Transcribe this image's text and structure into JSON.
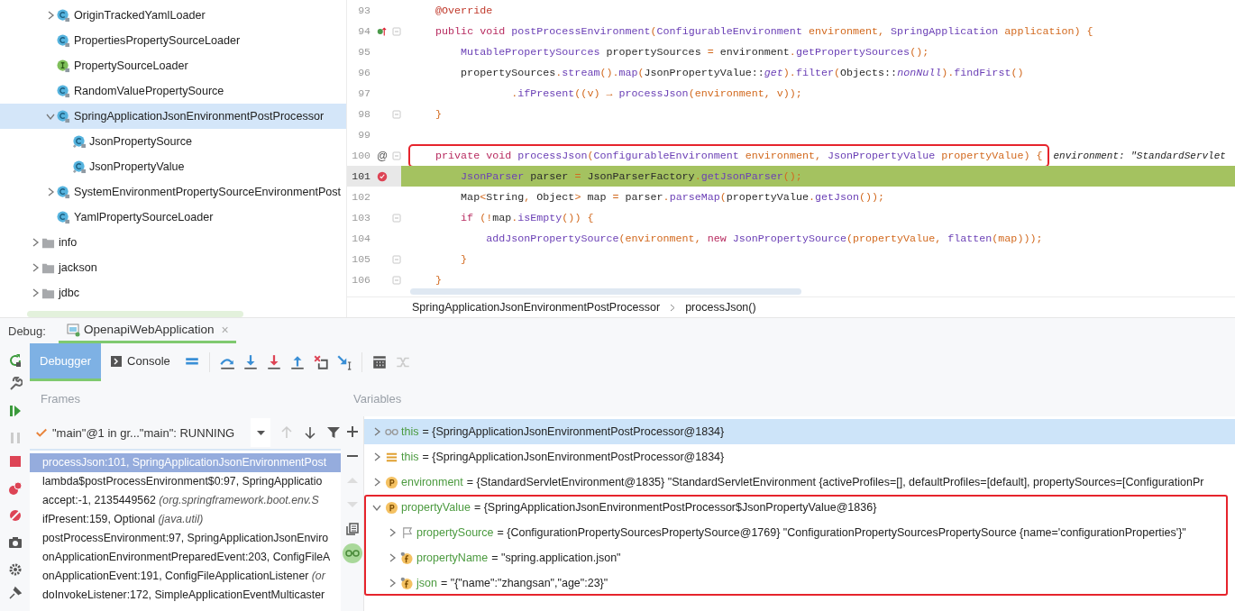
{
  "tree": {
    "nested_items": [
      {
        "label": "OriginTrackedYamlLoader",
        "kind": "class",
        "expanded": false,
        "selected": false
      },
      {
        "label": "PropertiesPropertySourceLoader",
        "kind": "class",
        "selected": false
      },
      {
        "label": "PropertySourceLoader",
        "kind": "interface",
        "selected": false
      },
      {
        "label": "RandomValuePropertySource",
        "kind": "class",
        "selected": false
      },
      {
        "label": "SpringApplicationJsonEnvironmentPostProcessor",
        "kind": "class",
        "expanded": true,
        "selected": true,
        "children": [
          {
            "label": "JsonPropertySource",
            "kind": "inner-class",
            "selected": false
          },
          {
            "label": "JsonPropertyValue",
            "kind": "inner-class",
            "selected": false
          }
        ]
      },
      {
        "label": "SystemEnvironmentPropertySourceEnvironmentPost",
        "kind": "class",
        "expanded": false,
        "selected": false
      },
      {
        "label": "YamlPropertySourceLoader",
        "kind": "class",
        "selected": false
      }
    ],
    "items": [
      {
        "label": "info",
        "kind": "folder",
        "expanded": false,
        "selected": false
      },
      {
        "label": "jackson",
        "kind": "folder",
        "expanded": false,
        "selected": false
      },
      {
        "label": "jdbc",
        "kind": "folder",
        "expanded": false,
        "selected": false
      }
    ]
  },
  "editor": {
    "lines": [
      {
        "number": "93",
        "kind": "plain",
        "fold": false,
        "text": "    @Override"
      },
      {
        "number": "94",
        "kind": "override",
        "fold": true,
        "text": "    public void postProcessEnvironment(ConfigurableEnvironment environment, SpringApplication application) {"
      },
      {
        "number": "95",
        "kind": "plain",
        "fold": false,
        "text": "        MutablePropertySources propertySources = environment.getPropertySources();"
      },
      {
        "number": "96",
        "kind": "plain",
        "fold": false,
        "text": "        propertySources.stream().map(JsonPropertyValue::get).filter(Objects::nonNull).findFirst()"
      },
      {
        "number": "97",
        "kind": "plain",
        "fold": false,
        "text": "                .ifPresent((v) → processJson(environment, v));"
      },
      {
        "number": "98",
        "kind": "plain",
        "fold": true,
        "text": "    }"
      },
      {
        "number": "99",
        "kind": "plain",
        "fold": false
      },
      {
        "number": "100",
        "kind": "annotated",
        "gutter_text": "@",
        "fold": true,
        "boxed": true,
        "hint": "environment: \"StandardServlet",
        "text": "    private void processJson(ConfigurableEnvironment environment, JsonPropertyValue propertyValue) {"
      },
      {
        "number": "101",
        "kind": "breakpoint",
        "current": true,
        "fold": false,
        "text": "        JsonParser parser = JsonParserFactory.getJsonParser();"
      },
      {
        "number": "102",
        "kind": "plain",
        "fold": false,
        "text": "        Map<String, Object> map = parser.parseMap(propertyValue.getJson());"
      },
      {
        "number": "103",
        "kind": "plain",
        "fold": true,
        "text": "        if (!map.isEmpty()) {"
      },
      {
        "number": "104",
        "kind": "plain",
        "fold": false,
        "text": "            addJsonPropertySource(environment, new JsonPropertySource(propertyValue, flatten(map)));"
      },
      {
        "number": "105",
        "kind": "plain",
        "fold": true,
        "text": "        }"
      },
      {
        "number": "106",
        "kind": "plain",
        "fold": true,
        "text": "    }"
      }
    ],
    "breadcrumb": [
      "SpringApplicationJsonEnvironmentPostProcessor",
      "processJson()"
    ]
  },
  "debug": {
    "label": "Debug:",
    "session_tab": {
      "title": "OpenapiWebApplication",
      "close": "×",
      "selected": true
    },
    "tabs": [
      {
        "label": "Debugger",
        "selected": true
      },
      {
        "label": "Console",
        "selected": false
      }
    ],
    "frames_label": "Frames",
    "variables_label": "Variables",
    "thread": "\"main\"@1 in gr...\"main\": RUNNING",
    "frames": [
      {
        "text": "processJson:101, SpringApplicationJsonEnvironmentPost",
        "selected": true
      },
      {
        "text": "lambda$postProcessEnvironment$0:97, SpringApplicatio",
        "selected": false
      },
      {
        "text": "accept:-1, 2135449562 *(org.springframework.boot.env.S*",
        "selected": false
      },
      {
        "text": "ifPresent:159, Optional *(java.util)*",
        "selected": false
      },
      {
        "text": "postProcessEnvironment:97, SpringApplicationJsonEnviro",
        "selected": false
      },
      {
        "text": "onApplicationEnvironmentPreparedEvent:203, ConfigFileA",
        "selected": false
      },
      {
        "text": "onApplicationEvent:191, ConfigFileApplicationListener *(or*",
        "selected": false
      },
      {
        "text": "doInvokeListener:172, SimpleApplicationEventMulticaster",
        "selected": false
      }
    ],
    "variables": [
      {
        "kind": "watch",
        "name": "this",
        "value": "= {SpringApplicationJsonEnvironmentPostProcessor@1834}",
        "expanded": false,
        "selected": true
      },
      {
        "kind": "list",
        "name": "this",
        "value": "= {SpringApplicationJsonEnvironmentPostProcessor@1834}",
        "expanded": false,
        "selected": false
      },
      {
        "kind": "param",
        "name": "environment",
        "value": "= {StandardServletEnvironment@1835} \"StandardServletEnvironment {activeProfiles=[], defaultProfiles=[default], propertySources=[ConfigurationPr",
        "expanded": false,
        "selected": false
      },
      {
        "kind": "param",
        "name": "propertyValue",
        "value": "= {SpringApplicationJsonEnvironmentPostProcessor$JsonPropertyValue@1836}",
        "expanded": true,
        "selected": false,
        "boxed": true,
        "children": [
          {
            "kind": "flag",
            "name": "propertySource",
            "value": "= {ConfigurationPropertySourcesPropertySource@1769} \"ConfigurationPropertySourcesPropertySource {name='configurationProperties'}\"",
            "expanded": false,
            "selected": false
          },
          {
            "kind": "field",
            "name": "propertyName",
            "value": "= \"spring.application.json\"",
            "expanded": false,
            "selected": false
          },
          {
            "kind": "field",
            "name": "json",
            "value": "= \"{\"name\":\"zhangsan\",\"age\":23}\"",
            "expanded": false,
            "selected": false
          }
        ]
      }
    ]
  }
}
